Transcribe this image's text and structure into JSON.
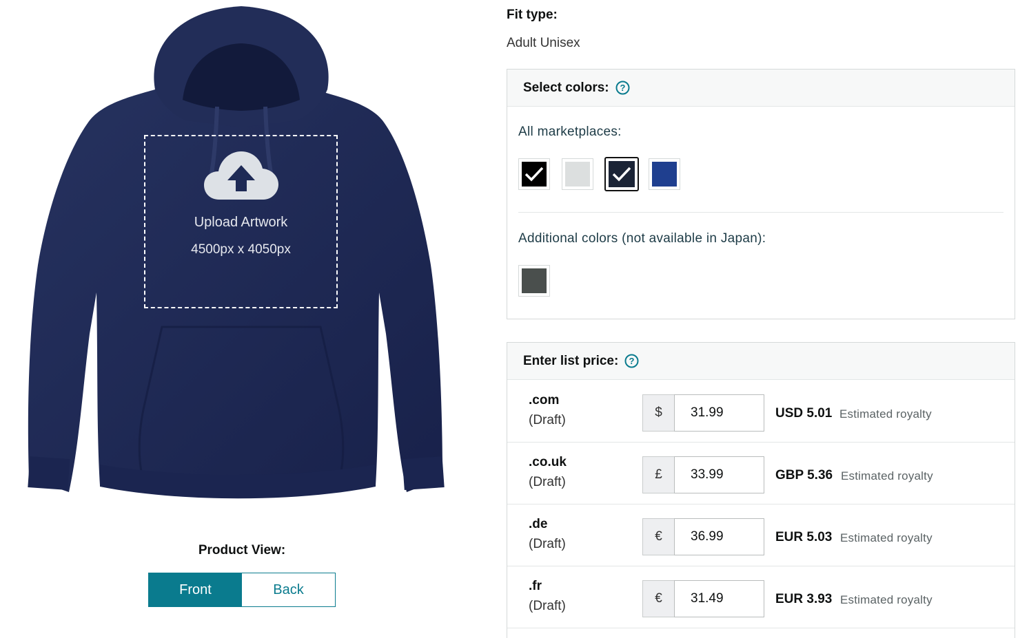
{
  "preview": {
    "upload_title": "Upload Artwork",
    "upload_size": "4500px x 4050px",
    "view_label": "Product View:",
    "view_front": "Front",
    "view_back": "Back",
    "hoodie_color": "#1e2a55"
  },
  "fit": {
    "label": "Fit type:",
    "value": "Adult Unisex"
  },
  "colors": {
    "title": "Select colors:",
    "all_label": "All marketplaces:",
    "additional_label": "Additional colors (not available in Japan):",
    "swatches": [
      {
        "name": "black",
        "hex": "#000000",
        "selected": true
      },
      {
        "name": "heather-grey",
        "hex": "#dcdfdf",
        "selected": false
      },
      {
        "name": "navy",
        "hex": "#1b2436",
        "selected": true
      },
      {
        "name": "royal-blue",
        "hex": "#1f3f8f",
        "selected": false
      }
    ],
    "additional_swatches": [
      {
        "name": "charcoal-heather",
        "hex": "#4a4f4d",
        "selected": false
      }
    ]
  },
  "price": {
    "title": "Enter list price:",
    "rows": [
      {
        "marketplace": ".com",
        "status": "(Draft)",
        "currency": "$",
        "value": "31.99",
        "royalty": "USD 5.01",
        "royalty_label": "Estimated royalty"
      },
      {
        "marketplace": ".co.uk",
        "status": "(Draft)",
        "currency": "£",
        "value": "33.99",
        "royalty": "GBP 5.36",
        "royalty_label": "Estimated royalty"
      },
      {
        "marketplace": ".de",
        "status": "(Draft)",
        "currency": "€",
        "value": "36.99",
        "royalty": "EUR 5.03",
        "royalty_label": "Estimated royalty"
      },
      {
        "marketplace": ".fr",
        "status": "(Draft)",
        "currency": "€",
        "value": "31.49",
        "royalty": "EUR 3.93",
        "royalty_label": "Estimated royalty"
      }
    ]
  },
  "accent": "#0a7b8e"
}
